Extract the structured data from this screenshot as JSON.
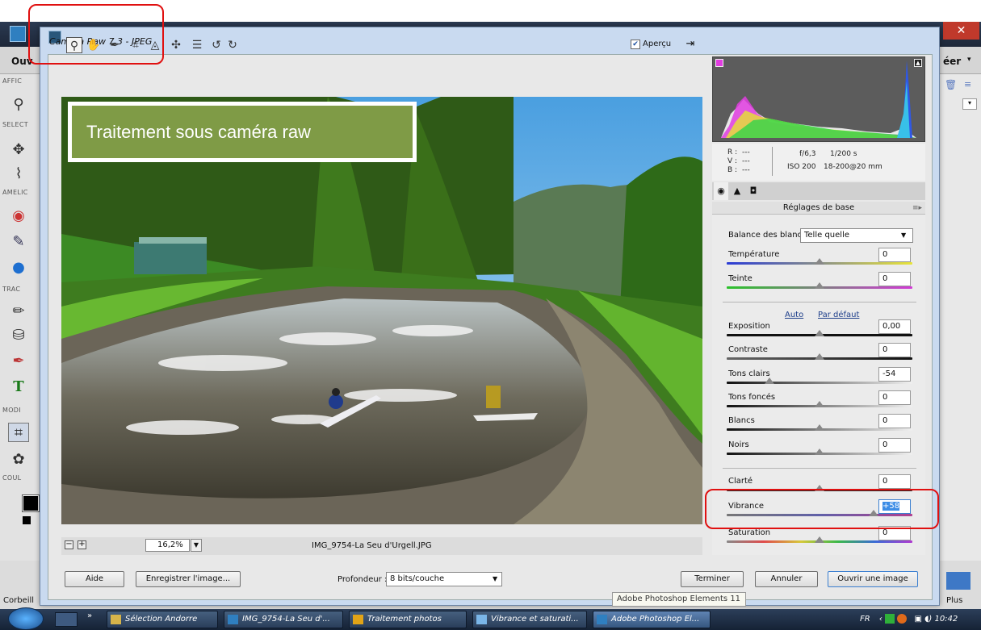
{
  "background_app": {
    "menu_left": "Ouv",
    "menu_right": "éer",
    "panel_sections": [
      "AFFIC",
      "SELECT",
      "AMELIC",
      "TRAC",
      "MODI",
      "COUL"
    ],
    "bottom_left": "Corbeill",
    "bottom_right": "Plus"
  },
  "dialog": {
    "title": "Camera Raw 7.3  -  JPEG",
    "preview_label": "Aperçu",
    "preview_checked": true
  },
  "annotation": {
    "text": "Traitement sous caméra raw"
  },
  "image_status": {
    "zoom": "16,2%",
    "filename": "IMG_9754-La Seu d'Urgell.JPG"
  },
  "info": {
    "r_label": "R :",
    "r_value": "---",
    "v_label": "V :",
    "v_value": "---",
    "b_label": "B :",
    "b_value": "---",
    "aperture": "f/6,3",
    "shutter": "1/200 s",
    "iso": "ISO 200",
    "lens": "18-200@20 mm"
  },
  "panel": {
    "title": "Réglages de base",
    "wb_label": "Balance des blancs :",
    "wb_value": "Telle quelle",
    "auto_link": "Auto",
    "default_link": "Par défaut",
    "sliders": [
      {
        "label": "Température",
        "value": "0",
        "level": 0.5
      },
      {
        "label": "Teinte",
        "value": "0",
        "level": 0.5
      },
      {
        "label": "Exposition",
        "value": "0,00",
        "level": 0.5
      },
      {
        "label": "Contraste",
        "value": "0",
        "level": 0.5
      },
      {
        "label": "Tons clairs",
        "value": "-54",
        "level": 0.23
      },
      {
        "label": "Tons foncés",
        "value": "0",
        "level": 0.5
      },
      {
        "label": "Blancs",
        "value": "0",
        "level": 0.5
      },
      {
        "label": "Noirs",
        "value": "0",
        "level": 0.5
      },
      {
        "label": "Clarté",
        "value": "0",
        "level": 0.5
      },
      {
        "label": "Vibrance",
        "value": "+58",
        "level": 0.79
      },
      {
        "label": "Saturation",
        "value": "0",
        "level": 0.5
      }
    ]
  },
  "buttons": {
    "help": "Aide",
    "save": "Enregistrer l'image...",
    "depth_label": "Profondeur :",
    "depth_value": "8 bits/couche",
    "done": "Terminer",
    "cancel": "Annuler",
    "open": "Ouvrir une image"
  },
  "tooltip": "Adobe Photoshop Elements 11",
  "taskbar": {
    "items": [
      "Sélection Andorre",
      "IMG_9754-La Seu d'...",
      "Traitement photos",
      "Vibrance et saturati...",
      "Adobe Photoshop El..."
    ],
    "lang": "FR",
    "time": "10:42"
  },
  "colors": {
    "accent_red": "#e01010",
    "annotation_green": "#7f9b46"
  }
}
